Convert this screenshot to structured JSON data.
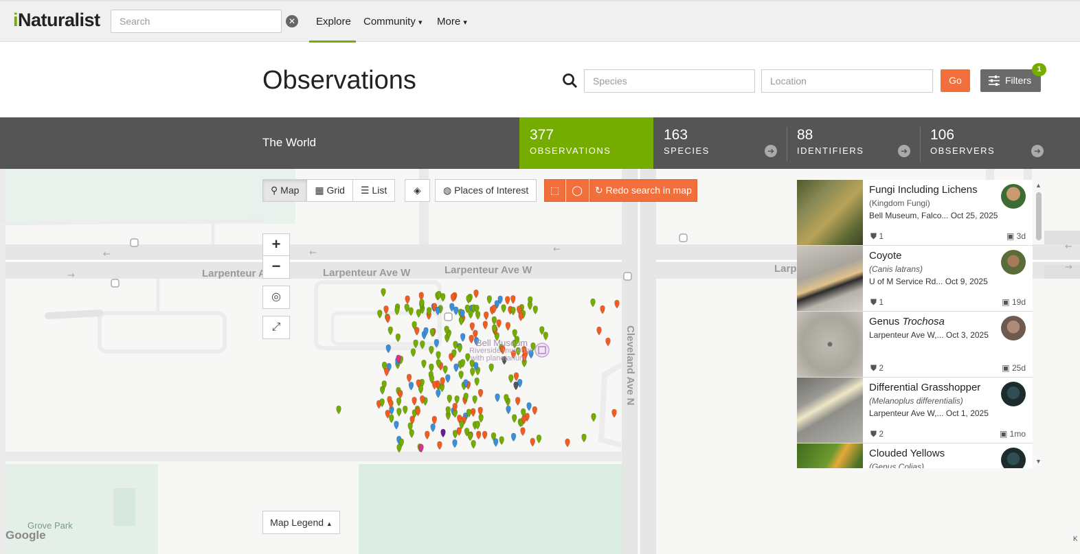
{
  "nav": {
    "logo": "iNaturalist",
    "search_placeholder": "Search",
    "explore": "Explore",
    "community": "Community",
    "more": "More",
    "caret": "▾"
  },
  "header": {
    "title": "Observations",
    "species_placeholder": "Species",
    "location_placeholder": "Location",
    "go": "Go",
    "filters": "Filters",
    "filters_count": "1"
  },
  "stats": {
    "place": "The World",
    "observations": {
      "num": "377",
      "label": "OBSERVATIONS"
    },
    "species": {
      "num": "163",
      "label": "SPECIES"
    },
    "identifiers": {
      "num": "88",
      "label": "IDENTIFIERS"
    },
    "observers": {
      "num": "106",
      "label": "OBSERVERS"
    }
  },
  "toolbar": {
    "map": "Map",
    "grid": "Grid",
    "list": "List",
    "places": "Places of Interest",
    "redo": "Redo search in map"
  },
  "map": {
    "zoom_in": "+",
    "zoom_out": "−",
    "legend": "Map Legend",
    "streets": [
      "Larpenteur Ave W",
      "Larpenteur Ave W",
      "Larpenteur Ave W",
      "Larp",
      "Cleveland Ave N"
    ],
    "poi": [
      "Bell Museum",
      "Riverside museum",
      "with planetarium",
      "Grove Park"
    ],
    "attribution": "Google",
    "corner": "K"
  },
  "observations": [
    {
      "name": "Fungi Including Lichens",
      "sci": "(Kingdom Fungi)",
      "place": "Bell Museum, Falco...",
      "date": "Oct 25, 2025",
      "ids": "1",
      "age": "3d"
    },
    {
      "name": "Coyote",
      "sci": "(Canis latrans)",
      "place": "U of M Service Rd...",
      "date": "Oct 9, 2025",
      "ids": "1",
      "age": "19d"
    },
    {
      "name_prefix": "Genus ",
      "name_italic": "Trochosa",
      "place": "Larpenteur Ave W,...",
      "date": "Oct 3, 2025",
      "ids": "2",
      "age": "25d"
    },
    {
      "name": "Differential Grasshopper",
      "sci": "(Melanoplus differentialis)",
      "place": "Larpenteur Ave W,...",
      "date": "Oct 1, 2025",
      "ids": "2",
      "age": "1mo"
    },
    {
      "name": "Clouded Yellows",
      "sci": "(Genus Colias)"
    }
  ],
  "colors": {
    "accent_green": "#74ac00",
    "accent_orange": "#f16f3a",
    "stats_bg": "#555555",
    "marker_green": "#74ac00",
    "marker_orange": "#f25c20",
    "marker_blue": "#3a8fd8",
    "marker_magenta": "#e0308a",
    "marker_purple": "#6a1b9a",
    "marker_gray": "#555555"
  }
}
